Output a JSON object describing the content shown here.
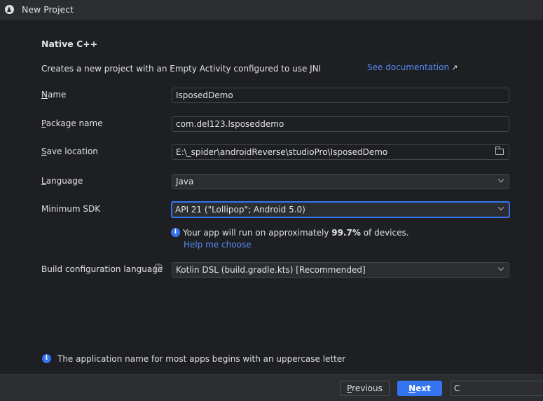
{
  "window": {
    "title": "New Project",
    "icon": "android-studio-icon"
  },
  "template": {
    "heading": "Native C++",
    "description": "Creates a new project with an Empty Activity configured to use JNI",
    "doc_link": "See documentation",
    "doc_link_icon": "↗"
  },
  "form": {
    "name": {
      "label_u": "N",
      "label_rest": "ame",
      "value": "IsposedDemo"
    },
    "package": {
      "label_u": "P",
      "label_rest": "ackage name",
      "value": "com.del123.lsposeddemo"
    },
    "save": {
      "label_u": "S",
      "label_rest": "ave location",
      "value": "E:\\_spider\\androidReverse\\studioPro\\IsposedDemo"
    },
    "language": {
      "label_u": "L",
      "label_rest": "anguage",
      "value": "Java"
    },
    "min_sdk": {
      "label": "Minimum SDK",
      "value": "API 21 (\"Lollipop\"; Android 5.0)"
    },
    "build_lang": {
      "label": "Build configuration language",
      "value": "Kotlin DSL (build.gradle.kts) [Recommended]"
    }
  },
  "sdk_info": {
    "prefix": "Your app will run on approximately ",
    "percent": "99.7%",
    "suffix": " of devices.",
    "help_link": "Help me choose"
  },
  "hint": "The application name for most apps begins with an uppercase letter",
  "buttons": {
    "previous_u": "P",
    "previous_rest": "revious",
    "next_u": "N",
    "next_rest": "ext",
    "cancel": "C"
  },
  "colors": {
    "accent": "#3574f0",
    "link": "#548af7",
    "background": "#1e1f22",
    "panel": "#2b2d30"
  }
}
